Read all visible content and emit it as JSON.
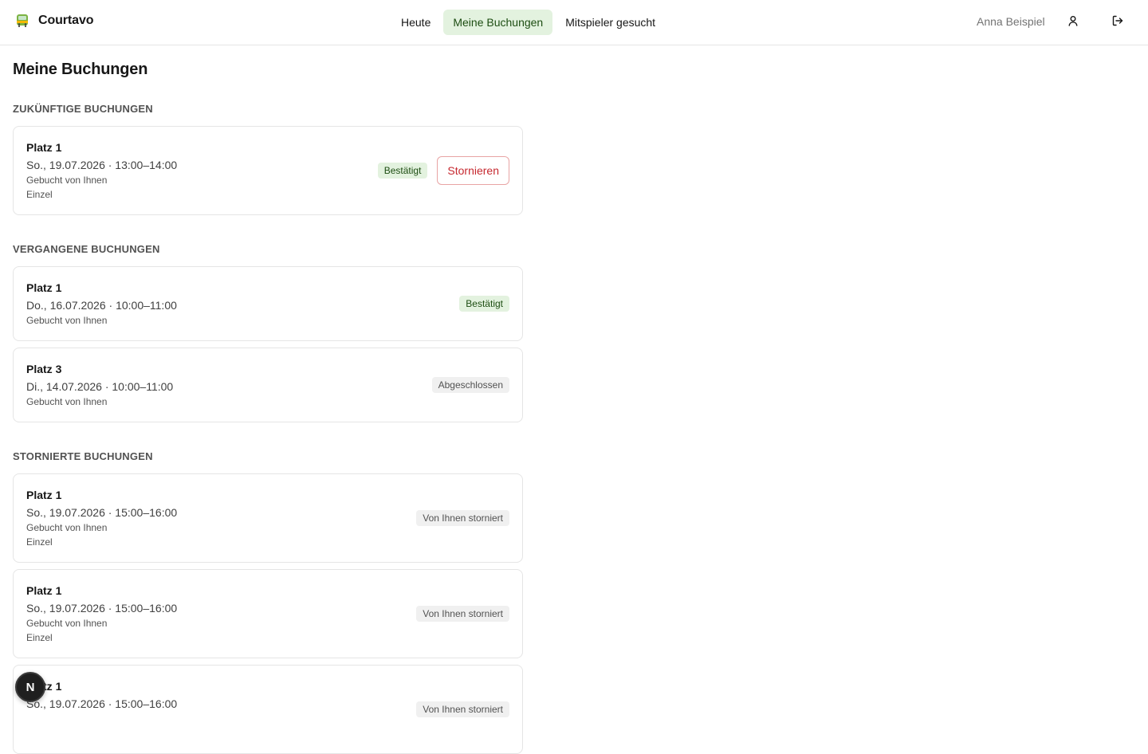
{
  "app": {
    "name": "Courtavo",
    "icon": "tram-icon"
  },
  "nav": {
    "items": [
      {
        "label": "Heute",
        "active": false
      },
      {
        "label": "Meine Buchungen",
        "active": true
      },
      {
        "label": "Mitspieler gesucht",
        "active": false
      }
    ]
  },
  "user": {
    "name": "Anna Beispiel",
    "profile_icon": "user-icon",
    "logout_icon": "logout-icon"
  },
  "page": {
    "title": "Meine Buchungen"
  },
  "sections": {
    "upcoming": {
      "title": "Zukünftige Buchungen",
      "cards": [
        {
          "court": "Platz 1",
          "date": "So., 19.07.2026 · 13:00–14:00",
          "booked_by": "Gebucht von Ihnen",
          "type": "Einzel",
          "status": "Bestätigt",
          "action": "Stornieren"
        }
      ]
    },
    "past": {
      "title": "Vergangene Buchungen",
      "cards": [
        {
          "court": "Platz 1",
          "date": "Do., 16.07.2026 · 10:00–11:00",
          "booked_by": "Gebucht von Ihnen",
          "status": "Bestätigt"
        },
        {
          "court": "Platz 3",
          "date": "Di., 14.07.2026 · 10:00–11:00",
          "booked_by": "Gebucht von Ihnen",
          "status": "Abgeschlossen"
        }
      ]
    },
    "cancelled": {
      "title": "Stornierte Buchungen",
      "cards": [
        {
          "court": "Platz 1",
          "date": "So., 19.07.2026 · 15:00–16:00",
          "booked_by": "Gebucht von Ihnen",
          "type": "Einzel",
          "status": "Von Ihnen storniert"
        },
        {
          "court": "Platz 1",
          "date": "So., 19.07.2026 · 15:00–16:00",
          "booked_by": "Gebucht von Ihnen",
          "type": "Einzel",
          "status": "Von Ihnen storniert"
        },
        {
          "court": "Platz 1",
          "date": "So., 19.07.2026 · 15:00–16:00",
          "status": "Von Ihnen storniert"
        }
      ]
    }
  },
  "fab": {
    "label": "N"
  },
  "colors": {
    "accent_bg": "#e3f2df",
    "accent_text": "#1d4d12",
    "danger": "#c6282f"
  }
}
